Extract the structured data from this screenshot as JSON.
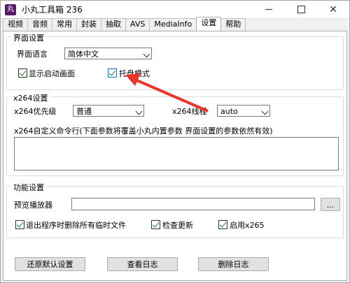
{
  "window": {
    "title": "小丸工具箱 236",
    "icon_text": "丸",
    "min_icon": "minimize-icon",
    "max_icon": "maximize-icon",
    "close_icon": "close-icon"
  },
  "tabs": [
    {
      "label": "视频"
    },
    {
      "label": "音频"
    },
    {
      "label": "常用"
    },
    {
      "label": "封装"
    },
    {
      "label": "抽取"
    },
    {
      "label": "AVS"
    },
    {
      "label": "MediaInfo"
    },
    {
      "label": "设置",
      "active": true
    },
    {
      "label": "帮助"
    }
  ],
  "interface": {
    "legend": "界面设置",
    "language_label": "界面语言",
    "language_value": "简体中文",
    "show_splash_label": "显示启动画面",
    "show_splash_checked": true,
    "tray_label": "托盘模式",
    "tray_checked": true
  },
  "x264": {
    "legend": "x264设置",
    "priority_label": "x264优先级",
    "priority_value": "普通",
    "threads_label": "x264线程",
    "threads_value": "auto",
    "custom_cmd_label": "x264自定义命令行(下面参数将覆盖小丸内置参数 界面设置的参数依然有效)",
    "custom_cmd_value": ""
  },
  "features": {
    "legend": "功能设置",
    "player_label": "预览播放器",
    "player_value": "",
    "browse_label": "...",
    "delete_temp_label": "退出程序时删除所有临时文件",
    "delete_temp_checked": true,
    "check_update_label": "检查更新",
    "check_update_checked": true,
    "enable_x265_label": "启用x265",
    "enable_x265_checked": true
  },
  "buttons": {
    "restore_defaults": "还原默认设置",
    "view_log": "查看日志",
    "delete_log": "删除日志"
  },
  "annotation": {
    "arrow_color": "#e8352b"
  }
}
